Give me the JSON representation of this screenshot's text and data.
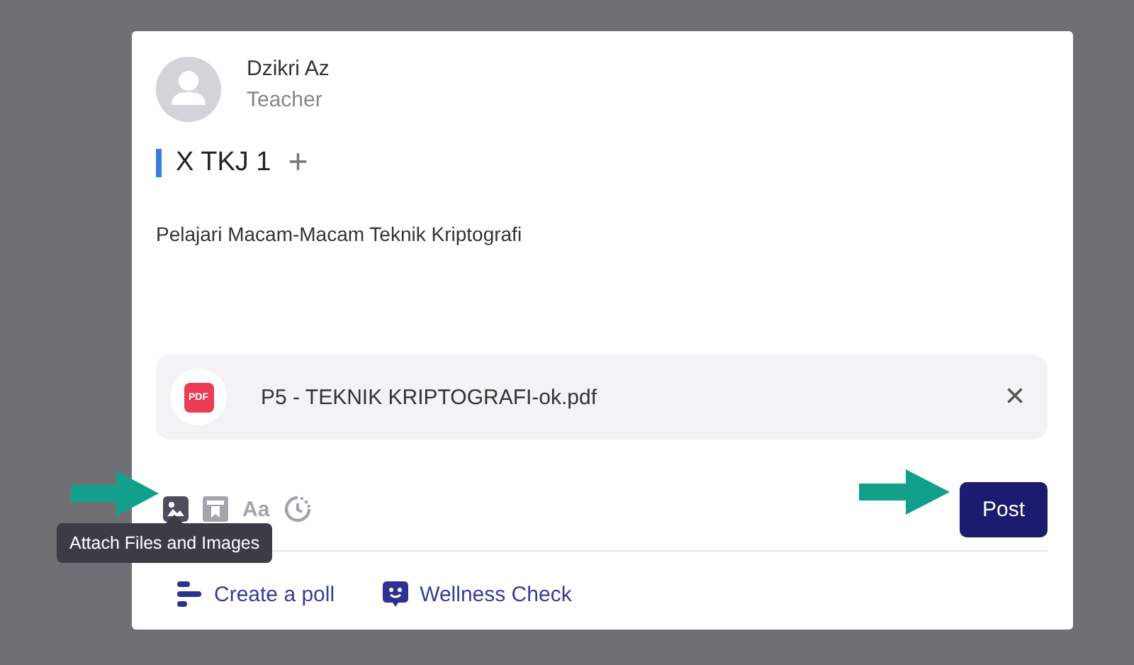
{
  "author": {
    "name": "Dzikri Az",
    "role": "Teacher"
  },
  "audience": {
    "label": "X TKJ 1",
    "add": "+"
  },
  "message": "Pelajari Macam-Macam Teknik Kriptografi",
  "attachment": {
    "badge": "PDF",
    "filename": "P5 - TEKNIK KRIPTOGRAFI-ok.pdf",
    "remove": "×"
  },
  "toolbar": [
    {
      "kind": "image",
      "hovered": true
    },
    {
      "kind": "bookmark",
      "hovered": false
    },
    {
      "kind": "text",
      "label": "Aa",
      "hovered": false
    },
    {
      "kind": "schedule",
      "hovered": false
    }
  ],
  "tooltip": "Attach Files and Images",
  "post_button": "Post",
  "extras": [
    {
      "kind": "poll",
      "label": "Create a poll"
    },
    {
      "kind": "wellness",
      "label": "Wellness Check"
    }
  ]
}
